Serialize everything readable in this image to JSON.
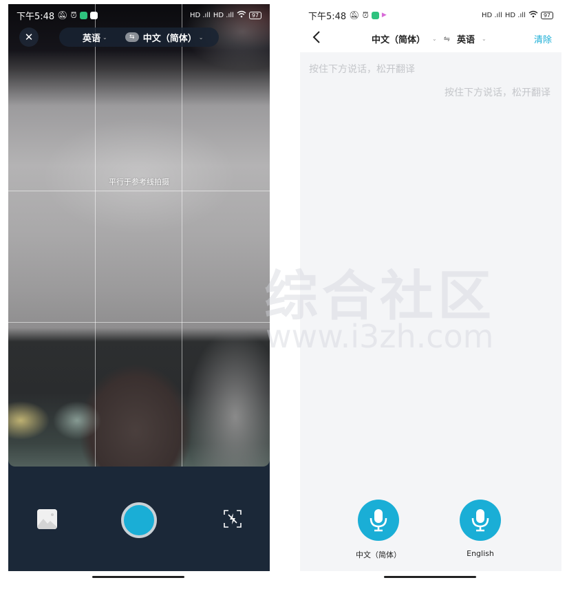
{
  "status_bar": {
    "time": "下午5:48",
    "signal_1": "HD .ıll",
    "signal_2": "HD .ıll",
    "battery": "97"
  },
  "camera_screen": {
    "source_language": "英语",
    "target_language": "中文（简体）",
    "swap_icon_label": "⇆",
    "guide_hint": "平行于参考线拍摄",
    "close_icon": "close-icon",
    "gallery_icon": "image-icon",
    "shutter_icon": "shutter-icon",
    "flash_icon": "flash-off-icon"
  },
  "voice_screen": {
    "source_language": "中文（简体）",
    "target_language": "英语",
    "swap_symbol": "⇋",
    "clear_label": "清除",
    "hint_source": "按住下方说话，松开翻译",
    "hint_target": "按住下方说话，松开翻译",
    "mic_buttons": [
      {
        "label": "中文（简体）",
        "icon": "microphone-icon"
      },
      {
        "label": "English",
        "icon": "microphone-icon"
      }
    ]
  },
  "watermark": {
    "text": "综合社区",
    "url": "www.i3zh.com"
  },
  "colors": {
    "accent": "#1aaed6",
    "camera_bottom_bg": "#1b2838",
    "voice_bg": "#f4f5f7",
    "hint_text": "#c4c6ca"
  }
}
